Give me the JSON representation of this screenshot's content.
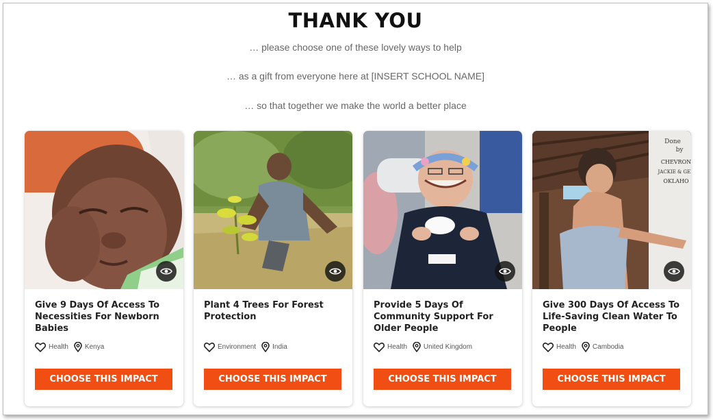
{
  "header": {
    "title": "THANK YOU",
    "line1": "… please choose one of these lovely ways to help",
    "line2": "… as a gift from everyone here at [INSERT SCHOOL NAME]",
    "line3": "… so that together we make the world a better place"
  },
  "cards": [
    {
      "title": "Give 9 Days Of Access To Necessities For Newborn Babies",
      "category": "Health",
      "location": "Kenya",
      "button": "CHOOSE THIS IMPACT",
      "photo": "newborn baby sleeping"
    },
    {
      "title": "Plant 4 Trees For Forest Protection",
      "category": "Environment",
      "location": "India",
      "button": "CHOOSE THIS IMPACT",
      "photo": "man sitting next to sapling in field"
    },
    {
      "title": "Provide 5 Days Of Community Support For Older People",
      "category": "Health",
      "location": "United Kingdom",
      "button": "CHOOSE THIS IMPACT",
      "photo": "smiling older woman with flower crown holding tea cup"
    },
    {
      "title": "Give 300 Days Of Access To Life-Saving Clean Water To People",
      "category": "Health",
      "location": "Cambodia",
      "button": "CHOOSE THIS IMPACT",
      "photo": "smiling girl at water station",
      "photo_sign": "Done by CHEVRON JACKIE & GERI OKLAHO"
    }
  ],
  "colors": {
    "accent": "#f04e12",
    "eye_button": "#141414"
  }
}
